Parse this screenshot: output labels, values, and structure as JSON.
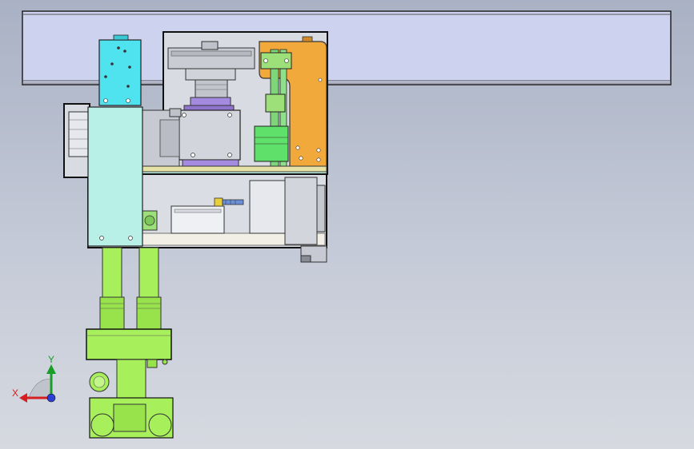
{
  "viewport": {
    "background_top": "#a9b1c4",
    "background_bottom": "#d6d9e0"
  },
  "colors": {
    "rail": "#cdd3ee",
    "cyan_block": "#4fe3f0",
    "teal_panel": "#b8efe6",
    "orange_bracket": "#f2a93b",
    "green_parts": "#a8ef5c",
    "green_module": "#5fe06a",
    "purple_ring": "#a58be0",
    "grey_housing": "#c7cad2",
    "outline": "#111111"
  },
  "triad": {
    "y_label": "Y",
    "x_label": "X",
    "icon": "coordinate-triad-icon"
  }
}
